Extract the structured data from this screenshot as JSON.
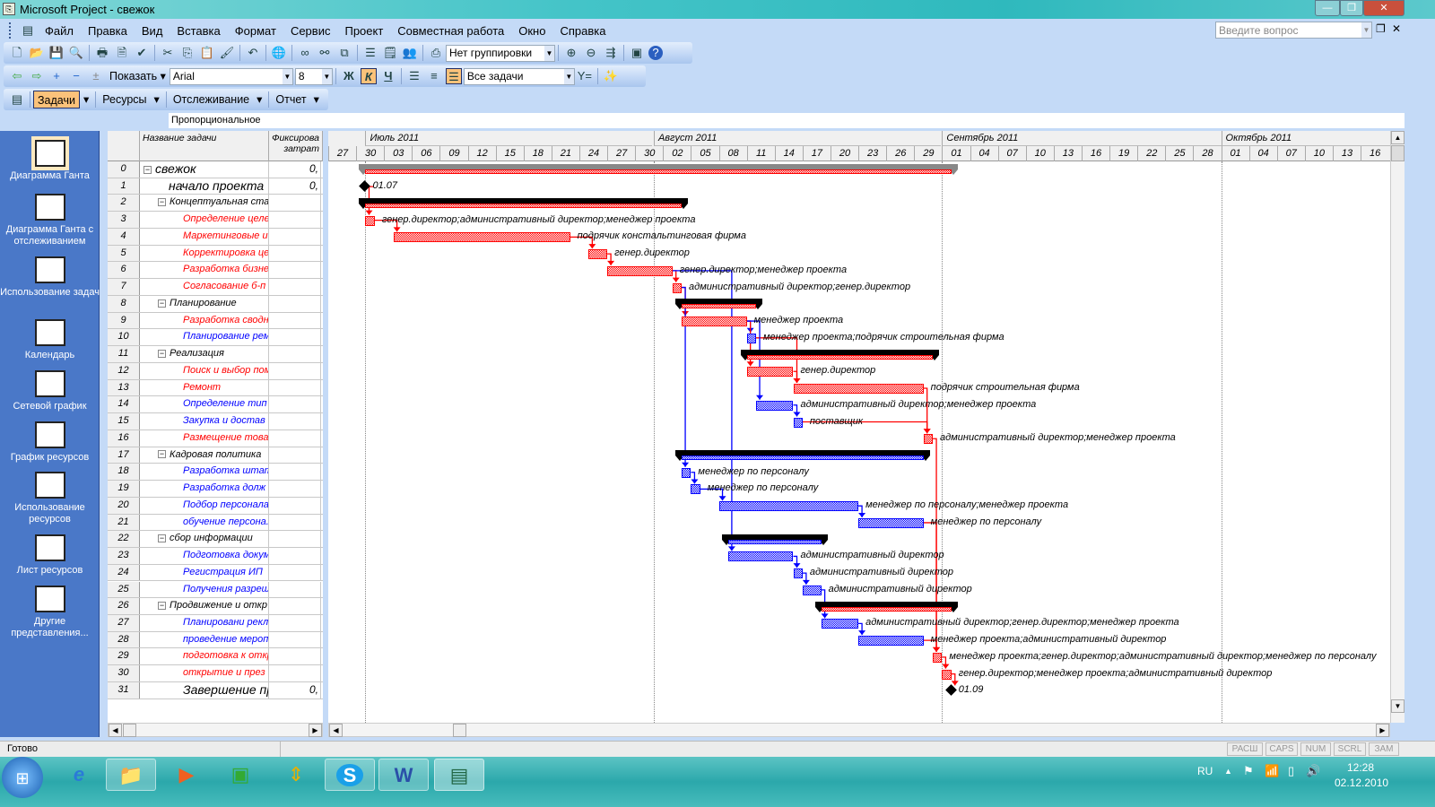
{
  "window": {
    "title": "Microsoft Project - свежок"
  },
  "menu": [
    "Файл",
    "Правка",
    "Вид",
    "Вставка",
    "Формат",
    "Сервис",
    "Проект",
    "Совместная работа",
    "Окно",
    "Справка"
  ],
  "help_search": {
    "placeholder": "Введите вопрос"
  },
  "toolbar1": {
    "grouping": "Нет группировки"
  },
  "toolbar2": {
    "show_label": "Показать",
    "font": "Arial",
    "size": "8",
    "bold": "Ж",
    "italic": "К",
    "underline": "Ч",
    "filter": "Все задачи"
  },
  "toolbar3": {
    "tasks": "Задачи",
    "resources": "Ресурсы",
    "tracking": "Отслеживание",
    "report": "Отчет"
  },
  "entry_bar": "Пропорциональное",
  "view_bar": [
    {
      "label": "Диаграмма Ганта",
      "icon": "gantt-chart-icon"
    },
    {
      "label": "Диаграмма Ганта с отслеживанием",
      "icon": "tracking-gantt-icon"
    },
    {
      "label": "Использование задач",
      "icon": "task-usage-icon"
    },
    {
      "label": "Календарь",
      "icon": "calendar-icon"
    },
    {
      "label": "Сетевой график",
      "icon": "network-diagram-icon"
    },
    {
      "label": "График ресурсов",
      "icon": "resource-graph-icon"
    },
    {
      "label": "Использование ресурсов",
      "icon": "resource-usage-icon"
    },
    {
      "label": "Лист ресурсов",
      "icon": "resource-sheet-icon"
    },
    {
      "label": "Другие представления...",
      "icon": "more-views-icon"
    }
  ],
  "table": {
    "col_name": "Название задачи",
    "col_cost": "Фиксирова затрат"
  },
  "timescale": {
    "origin": "2011-06-27",
    "months": [
      {
        "label": "Июль 2011",
        "start": "2011-07-01"
      },
      {
        "label": "Август 2011",
        "start": "2011-08-01"
      },
      {
        "label": "Сентябрь 2011",
        "start": "2011-09-01"
      },
      {
        "label": "Октябрь 2011",
        "start": "2011-10-01"
      }
    ],
    "ticks": [
      "27",
      "30",
      "03",
      "06",
      "09",
      "12",
      "15",
      "18",
      "21",
      "24",
      "27",
      "30",
      "02",
      "05",
      "08",
      "11",
      "14",
      "17",
      "20",
      "23",
      "26",
      "29",
      "01",
      "04",
      "07",
      "10",
      "13",
      "16",
      "19",
      "22",
      "25",
      "28",
      "01",
      "04",
      "07",
      "10",
      "13",
      "16"
    ]
  },
  "colors": {
    "critical": "#ff0000",
    "normal": "#0000ff",
    "summary": "#000000"
  },
  "tasks": [
    {
      "id": "0",
      "name": "свежок",
      "level": 0,
      "type": "project",
      "cost": "0,",
      "start": "2011-07-01",
      "end": "2011-09-02",
      "color": "#000000"
    },
    {
      "id": "1",
      "name": "начало проекта",
      "level": 1,
      "type": "milestone",
      "cost": "0,",
      "start": "2011-07-01",
      "label": "01.07",
      "color": "#000000"
    },
    {
      "id": "2",
      "name": "Концептуальная ста",
      "level": 1,
      "type": "summary",
      "start": "2011-07-01",
      "end": "2011-08-04",
      "crit": true
    },
    {
      "id": "3",
      "name": "Определение целе",
      "level": 2,
      "type": "task",
      "crit": true,
      "start": "2011-07-01",
      "end": "2011-07-02",
      "label": "генер.директор;административный директор;менеджер проекта",
      "pred": [
        "1"
      ]
    },
    {
      "id": "4",
      "name": "Маркетинговые и",
      "level": 2,
      "type": "task",
      "crit": true,
      "start": "2011-07-04",
      "end": "2011-07-23",
      "label": "подрячик констальтинговая фирма",
      "pred": [
        "3"
      ]
    },
    {
      "id": "5",
      "name": "Корректировка це",
      "level": 2,
      "type": "task",
      "crit": true,
      "start": "2011-07-25",
      "end": "2011-07-27",
      "label": "генер.директор",
      "pred": [
        "4"
      ]
    },
    {
      "id": "6",
      "name": "Разработка бизне",
      "level": 2,
      "type": "task",
      "crit": true,
      "start": "2011-07-27",
      "end": "2011-08-03",
      "label": "генер.директор;менеджер проекта",
      "pred": [
        "5"
      ]
    },
    {
      "id": "7",
      "name": "Согласование б-п",
      "level": 2,
      "type": "task",
      "crit": true,
      "start": "2011-08-03",
      "end": "2011-08-04",
      "label": "административный директор;генер.директор",
      "pred": [
        "6"
      ]
    },
    {
      "id": "8",
      "name": "Планирование",
      "level": 1,
      "type": "summary",
      "start": "2011-08-04",
      "end": "2011-08-12",
      "crit": true
    },
    {
      "id": "9",
      "name": "Разработка сводн",
      "level": 2,
      "type": "task",
      "crit": true,
      "start": "2011-08-04",
      "end": "2011-08-11",
      "label": "менеджер проекта",
      "pred": [
        "7"
      ]
    },
    {
      "id": "10",
      "name": "Планирование рем",
      "level": 2,
      "type": "task",
      "crit": false,
      "start": "2011-08-11",
      "end": "2011-08-12",
      "label": "менеджер проекта;подрячик  строительная фирма",
      "pred": [
        "9"
      ]
    },
    {
      "id": "11",
      "name": "Реализация",
      "level": 1,
      "type": "summary",
      "start": "2011-08-11",
      "end": "2011-08-31",
      "crit": true
    },
    {
      "id": "12",
      "name": "Поиск и выбор пом",
      "level": 2,
      "type": "task",
      "crit": true,
      "start": "2011-08-11",
      "end": "2011-08-16",
      "label": "генер.директор",
      "pred": [
        "9"
      ]
    },
    {
      "id": "13",
      "name": "Ремонт",
      "level": 2,
      "type": "task",
      "crit": true,
      "start": "2011-08-16",
      "end": "2011-08-30",
      "label": "подрячик  строительная фирма",
      "pred": [
        "12",
        "10"
      ]
    },
    {
      "id": "14",
      "name": "Определение тип",
      "level": 2,
      "type": "task",
      "crit": false,
      "start": "2011-08-12",
      "end": "2011-08-16",
      "label": "административный директор;менеджер проекта",
      "pred": [
        "9"
      ]
    },
    {
      "id": "15",
      "name": "Закупка и достав",
      "level": 2,
      "type": "task",
      "crit": false,
      "start": "2011-08-16",
      "end": "2011-08-17",
      "label": "поставщик",
      "pred": [
        "14"
      ]
    },
    {
      "id": "16",
      "name": "Размещение това",
      "level": 2,
      "type": "task",
      "crit": true,
      "start": "2011-08-30",
      "end": "2011-08-31",
      "label": "административный директор;менеджер проекта",
      "pred": [
        "13",
        "15"
      ]
    },
    {
      "id": "17",
      "name": "Кадровая политика",
      "level": 1,
      "type": "summary",
      "start": "2011-08-04",
      "end": "2011-08-30",
      "crit": false
    },
    {
      "id": "18",
      "name": "Разработка штат",
      "level": 2,
      "type": "task",
      "crit": false,
      "start": "2011-08-04",
      "end": "2011-08-05",
      "label": "менеджер по персоналу",
      "pred": [
        "7"
      ]
    },
    {
      "id": "19",
      "name": "Разработка долж",
      "level": 2,
      "type": "task",
      "crit": false,
      "start": "2011-08-05",
      "end": "2011-08-06",
      "label": "менеджер по персоналу",
      "pred": [
        "18"
      ]
    },
    {
      "id": "20",
      "name": "Подбор персонала",
      "level": 2,
      "type": "task",
      "crit": false,
      "start": "2011-08-08",
      "end": "2011-08-23",
      "label": "менеджер по персоналу;менеджер проекта",
      "pred": [
        "19"
      ]
    },
    {
      "id": "21",
      "name": "обучение персона.",
      "level": 2,
      "type": "task",
      "crit": false,
      "start": "2011-08-23",
      "end": "2011-08-30",
      "label": "менеджер по персоналу",
      "pred": [
        "20"
      ]
    },
    {
      "id": "22",
      "name": "сбор информации",
      "level": 1,
      "type": "summary",
      "start": "2011-08-09",
      "end": "2011-08-19",
      "crit": false
    },
    {
      "id": "23",
      "name": "Подготовка докум",
      "level": 2,
      "type": "task",
      "crit": false,
      "start": "2011-08-09",
      "end": "2011-08-16",
      "label": "административный директор",
      "pred": [
        "6"
      ]
    },
    {
      "id": "24",
      "name": "Регистрация ИП",
      "level": 2,
      "type": "task",
      "crit": false,
      "start": "2011-08-16",
      "end": "2011-08-17",
      "label": "административный директор",
      "pred": [
        "23"
      ]
    },
    {
      "id": "25",
      "name": "Получения разреш",
      "level": 2,
      "type": "task",
      "crit": false,
      "start": "2011-08-17",
      "end": "2011-08-19",
      "label": "административный директор",
      "pred": [
        "24"
      ]
    },
    {
      "id": "26",
      "name": "Продвижение и откр",
      "level": 1,
      "type": "summary",
      "start": "2011-08-19",
      "end": "2011-09-02",
      "crit": true
    },
    {
      "id": "27",
      "name": "Планировани рекл",
      "level": 2,
      "type": "task",
      "crit": false,
      "start": "2011-08-19",
      "end": "2011-08-23",
      "label": "административный директор;генер.директор;менеджер проекта",
      "pred": [
        "25"
      ]
    },
    {
      "id": "28",
      "name": "проведение мероп",
      "level": 2,
      "type": "task",
      "crit": false,
      "start": "2011-08-23",
      "end": "2011-08-30",
      "label": "менеджер проекта;административный директор",
      "pred": [
        "27"
      ]
    },
    {
      "id": "29",
      "name": "подготовка к откр",
      "level": 2,
      "type": "task",
      "crit": true,
      "start": "2011-08-31",
      "end": "2011-09-01",
      "label": "менеджер проекта;генер.директор;административный директор;менеджер по персоналу",
      "pred": [
        "16",
        "21",
        "28"
      ]
    },
    {
      "id": "30",
      "name": "открытие и през",
      "level": 2,
      "type": "task",
      "crit": true,
      "start": "2011-09-01",
      "end": "2011-09-02",
      "label": "генер.директор;менеджер проекта;административный директор",
      "pred": [
        "29"
      ]
    },
    {
      "id": "31",
      "name": "Завершение пр",
      "level": 2,
      "type": "milestone",
      "cost": "0,",
      "start": "2011-09-02",
      "label": "01.09",
      "pred": [
        "30"
      ],
      "color": "#000000"
    }
  ],
  "status": {
    "text": "Готово",
    "indicators": [
      "РАСШ",
      "CAPS",
      "NUM",
      "SCRL",
      "ЗАМ"
    ]
  },
  "taskbar": {
    "lang": "RU",
    "time": "12:28",
    "date": "02.12.2010"
  }
}
